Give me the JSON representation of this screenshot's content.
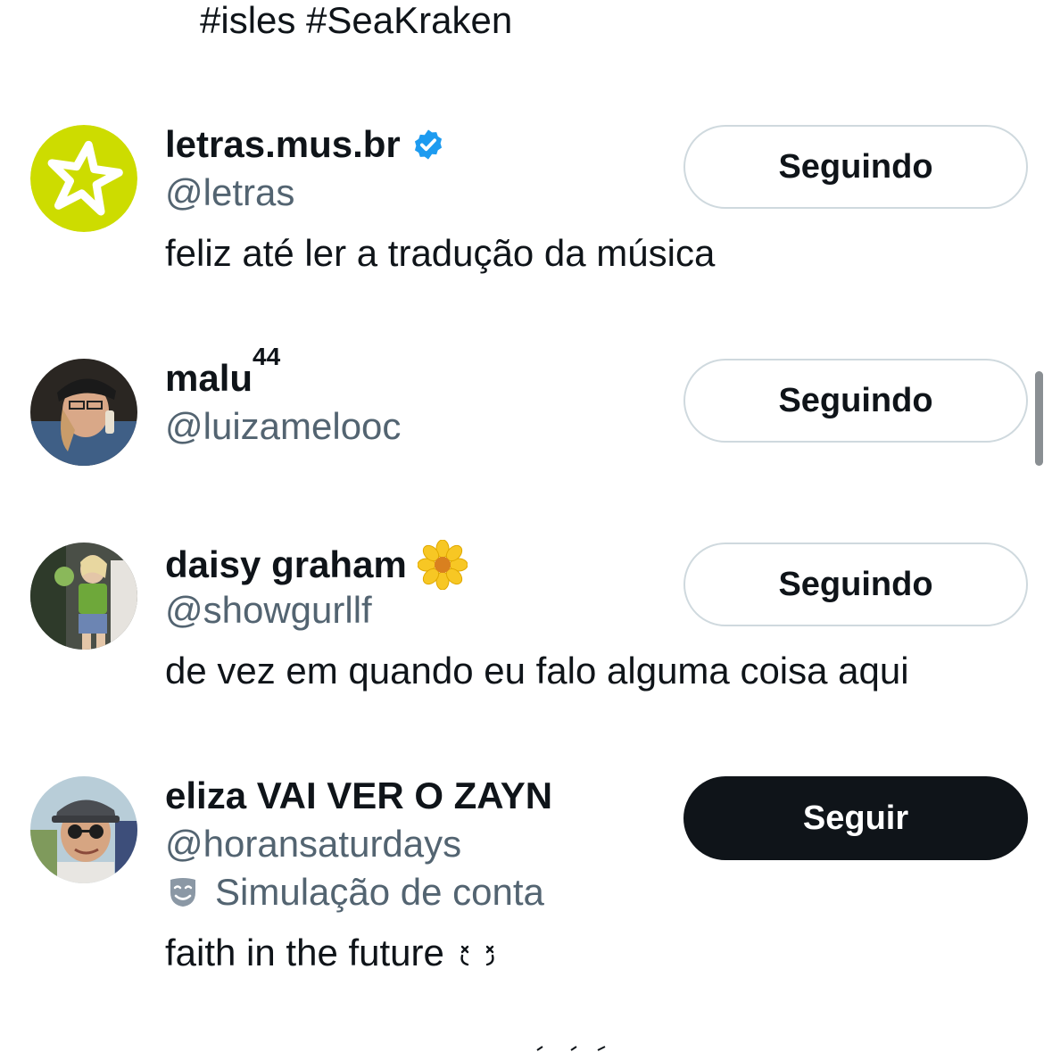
{
  "top_bio": "#isles #SeaKraken",
  "users": [
    {
      "name": "letras.mus.br",
      "name_sup": "",
      "verified": true,
      "handle": "@letras",
      "parody_label": "",
      "bio": "feliz até ler a tradução da música",
      "button_label": "Seguindo",
      "avatar": "star-logo-icon"
    },
    {
      "name": "malu",
      "name_sup": "44",
      "verified": false,
      "handle": "@luizamelooc",
      "parody_label": "",
      "bio": "",
      "button_label": "Seguindo",
      "avatar": "photo"
    },
    {
      "name": "daisy graham",
      "name_sup": "",
      "emoji": "🌼",
      "verified": false,
      "handle": "@showgurllf",
      "parody_label": "",
      "bio": "de vez em quando eu falo alguma coisa aqui",
      "button_label": "Seguindo",
      "avatar": "photo"
    },
    {
      "name": "eliza VAI VER O ZAYN",
      "name_sup": "",
      "verified": false,
      "handle": "@horansaturdays",
      "parody_label": "Simulação de conta",
      "bio": "faith in the future",
      "button_label": "Seguir",
      "avatar": "photo"
    }
  ],
  "colors": {
    "text": "#0f1419",
    "secondary": "#536471",
    "verified": "#1d9bf0",
    "follow_bg": "#0f1419",
    "border": "#cfd9de",
    "letras_avatar": "#cddc00"
  }
}
